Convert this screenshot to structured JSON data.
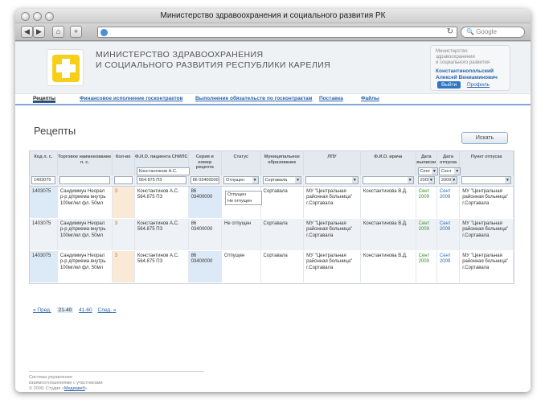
{
  "window": {
    "title": "Министерство здравоохранения и социального развития РК"
  },
  "browser": {
    "search_placeholder": "Google"
  },
  "header": {
    "org_line1": "МИНИСТЕРСТВО ЗДРАВООХРАНЕНИЯ",
    "org_line2": "И СОЦИАЛЬНОГО РАЗВИТИЯ РЕСПУБЛИКИ КАРЕЛИЯ",
    "user_org_line1": "Министерство здравоохранения",
    "user_org_line2": "и социального развития",
    "user_name_line1": "Константинопольский",
    "user_name_line2": "Алексей Вениаминович",
    "logout": "Выйти",
    "profile": "Профиль"
  },
  "tabs": [
    "Рецепты",
    "Финансовое исполнение госконтрактов",
    "Выполнение обязательств по госконтрактам",
    "Поставка",
    "Файлы"
  ],
  "page": {
    "title": "Рецепты",
    "search_button": "Искать"
  },
  "table": {
    "headers": [
      "Код л. с.",
      "Торговое наименование л. с.",
      "Кол-во",
      "Ф.И.О. пациента СНИЛС",
      "Серия и номер рецепта",
      "Статус",
      "Муниципальное образование",
      "ЛПУ",
      "Ф.И.О. врача",
      "Дата выписки",
      "Дата отпуска",
      "Пункт отпуска"
    ],
    "filters": {
      "code": "1403075",
      "patient": "Константинов А.С. 564.875 ПЗ",
      "patient1": "Константинов А.С.",
      "patient2": "564.875 ПЗ",
      "recipe": "86 03400000",
      "status": "Отпущен",
      "municipal": "Сортавала",
      "date1_month": "Сент",
      "date1_year": "2009",
      "date2_month": "Сент",
      "date2_year": "2009"
    },
    "status_options": [
      "Отпущен",
      "Не отпущен"
    ],
    "rows": [
      {
        "code": "1403075",
        "name": "Сандиммун Неорал р-р д/приема внутрь 100мг/мл фл. 50мл",
        "qty": "3",
        "patient": "Константинов А.С. 564.875 ПЗ",
        "recipe": "86 03400000",
        "status": "",
        "municipal": "Сортавала",
        "lpu": "МУ \"Центральная районная больница\" г.Сортавала",
        "doctor": "Константинова В.Д.",
        "date_issue_m": "Сент",
        "date_issue_y": "2009",
        "date_release_m": "Сент",
        "date_release_y": "2009",
        "point": "МУ \"Центральная районная больница\" г.Сортавала"
      },
      {
        "code": "1403075",
        "name": "Сандиммун Неорал р-р д/приема внутрь 100мг/мл фл. 50мл",
        "qty": "3",
        "patient": "Константинов А.С. 564.875 ПЗ",
        "recipe": "86 03400000",
        "status": "Не отпущен",
        "municipal": "Сортавала",
        "lpu": "МУ \"Центральная районная больница\" г.Сортавала",
        "doctor": "Константинова В.Д.",
        "date_issue_m": "Сент",
        "date_issue_y": "2009",
        "date_release_m": "Сент",
        "date_release_y": "2009",
        "point": "МУ \"Центральная районная больница\" г.Сортавала"
      },
      {
        "code": "1403075",
        "name": "Сандиммун Неорал р-р д/приема внутрь 100мг/мл фл. 50мл",
        "qty": "3",
        "patient": "Константинов А.С. 564.875 ПЗ",
        "recipe": "86 03400000",
        "status": "Отпущен",
        "municipal": "Сортавала",
        "lpu": "МУ \"Центральная районная больница\" г.Сортавала",
        "doctor": "Константинова В.Д.",
        "date_issue_m": "Сент",
        "date_issue_y": "2009",
        "date_release_m": "Сент",
        "date_release_y": "2009",
        "point": "МУ \"Центральная районная больница\" г.Сортавала"
      }
    ]
  },
  "pager": {
    "prev": "« Пред.",
    "cur": "21-40",
    "next_range": "41-60",
    "next": "След. »"
  },
  "footer": {
    "line1": "Система управления",
    "line2": "взаимоотношениями с участниками",
    "copyright": "© 2009, Студия «",
    "studio": "Медиавеб",
    "end": "»"
  }
}
